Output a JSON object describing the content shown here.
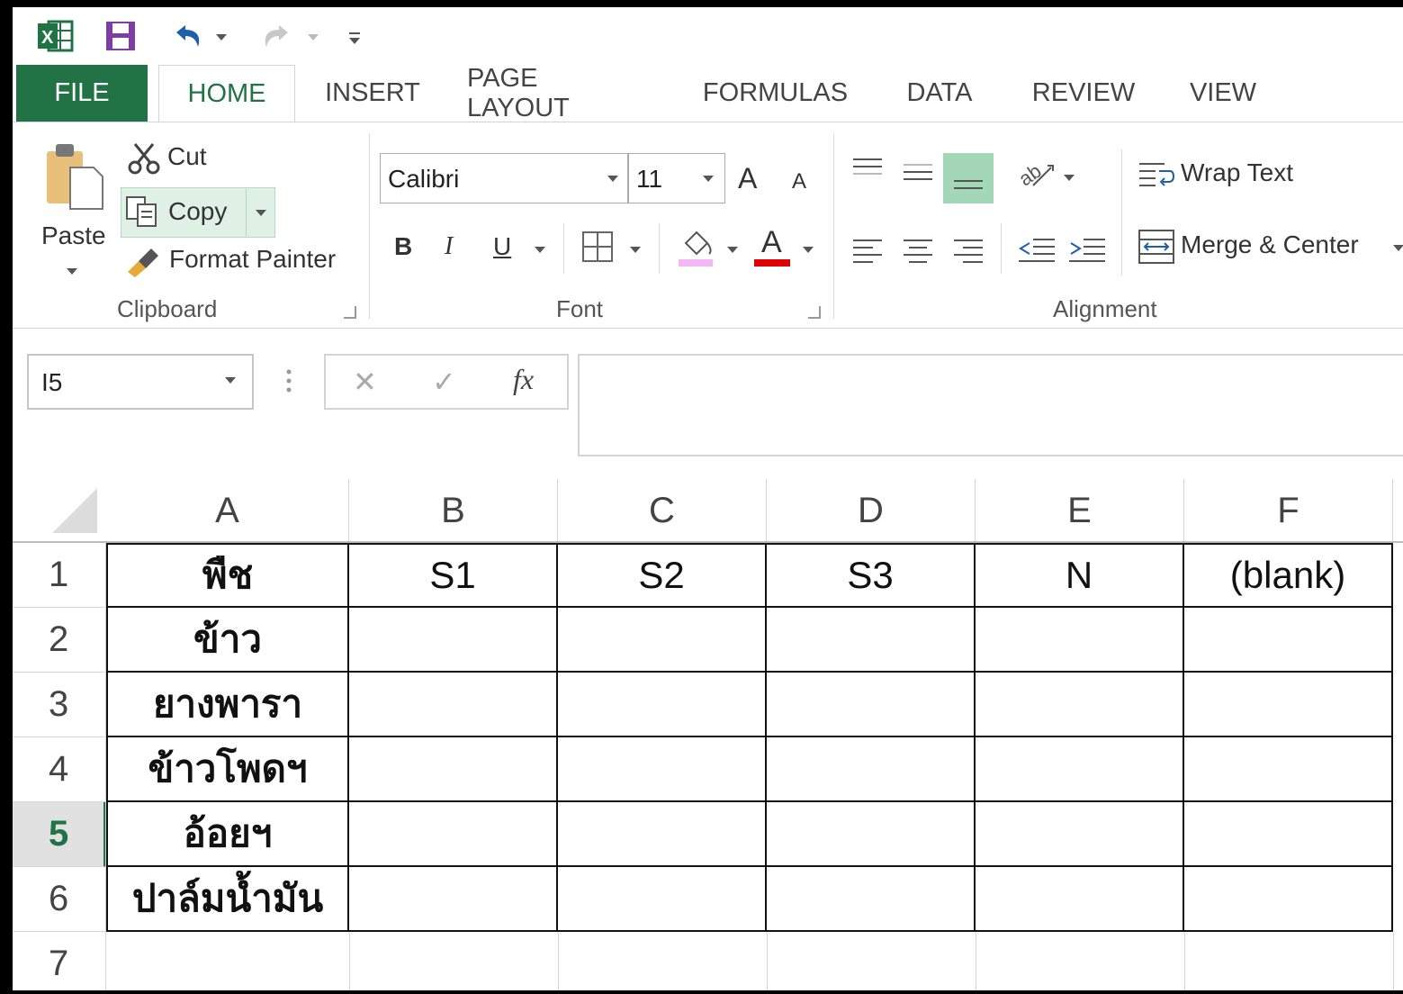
{
  "qat": {
    "excel_icon": "excel-logo-icon",
    "save_icon": "save-icon",
    "undo_icon": "undo-icon",
    "redo_icon": "redo-icon",
    "customize_icon": "customize-qat-icon"
  },
  "tabs": [
    {
      "label": "FILE"
    },
    {
      "label": "HOME"
    },
    {
      "label": "INSERT"
    },
    {
      "label": "PAGE LAYOUT"
    },
    {
      "label": "FORMULAS"
    },
    {
      "label": "DATA"
    },
    {
      "label": "REVIEW"
    },
    {
      "label": "VIEW"
    }
  ],
  "clipboard": {
    "paste": "Paste",
    "cut": "Cut",
    "copy": "Copy",
    "format_painter": "Format Painter",
    "group": "Clipboard"
  },
  "font": {
    "name": "Calibri",
    "size": "11",
    "bold": "B",
    "italic": "I",
    "underline": "U",
    "grow": "A",
    "shrink": "A",
    "font_color": "A",
    "group": "Font",
    "fill_color": "#f4b6f4",
    "font_color_bar": "#e00000"
  },
  "alignment": {
    "wrap_text": "Wrap Text",
    "merge_center": "Merge & Center",
    "group": "Alignment",
    "active_color": "#a3d7b8"
  },
  "formula_bar": {
    "name_box": "I5",
    "cancel": "✕",
    "enter": "✓",
    "fx": "fx",
    "value": ""
  },
  "grid": {
    "columns": [
      "A",
      "B",
      "C",
      "D",
      "E",
      "F"
    ],
    "rows": [
      "1",
      "2",
      "3",
      "4",
      "5",
      "6",
      "7"
    ],
    "active_row": "5",
    "active_color": "#217346",
    "cells": [
      [
        "พืช",
        "S1",
        "S2",
        "S3",
        "N",
        "(blank)"
      ],
      [
        "ข้าว",
        "",
        "",
        "",
        "",
        ""
      ],
      [
        "ยางพารา",
        "",
        "",
        "",
        "",
        ""
      ],
      [
        "ข้าวโพดฯ",
        "",
        "",
        "",
        "",
        ""
      ],
      [
        "อ้อยฯ",
        "",
        "",
        "",
        "",
        ""
      ],
      [
        "ปาล์มน้ำมัน",
        "",
        "",
        "",
        "",
        ""
      ],
      [
        "",
        "",
        "",
        "",
        "",
        ""
      ]
    ]
  }
}
